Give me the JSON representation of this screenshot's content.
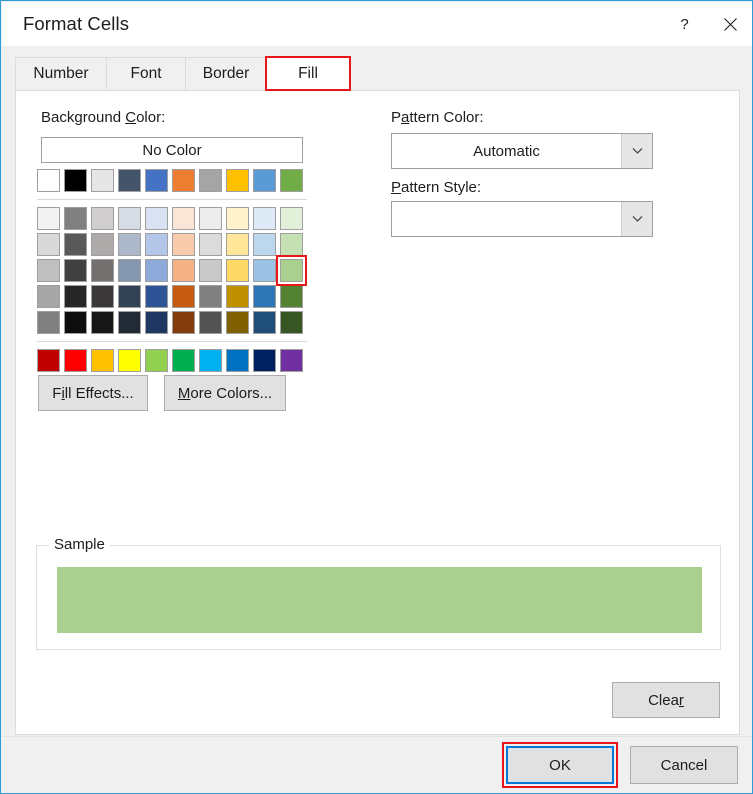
{
  "window": {
    "title": "Format Cells",
    "help_icon": "question-mark-icon",
    "close_icon": "close-icon",
    "border_color": "#2e9bd6"
  },
  "tabs": [
    {
      "label": "Number",
      "active": false,
      "highlighted": false
    },
    {
      "label": "Font",
      "active": false,
      "highlighted": false
    },
    {
      "label": "Border",
      "active": false,
      "highlighted": false
    },
    {
      "label": "Fill",
      "active": true,
      "highlighted": true
    }
  ],
  "fill_tab": {
    "background_color": {
      "label_before": "Background ",
      "label_accel": "C",
      "label_after": "olor:",
      "no_color_button": "No Color",
      "theme_colors": [
        "#FFFFFF",
        "#000000",
        "#E7E6E6",
        "#44546A",
        "#4472C4",
        "#ED7D31",
        "#A5A5A5",
        "#FFC000",
        "#5B9BD5",
        "#70AD47"
      ],
      "tint_shade_rows": [
        [
          "#F2F2F2",
          "#808080",
          "#D0CECE",
          "#D6DCE4",
          "#D9E2F3",
          "#FBE5D6",
          "#EDEDED",
          "#FFF2CC",
          "#DEEBF6",
          "#E2EFD9"
        ],
        [
          "#D9D9D9",
          "#595959",
          "#AEAAAA",
          "#ADB9CA",
          "#B4C6E7",
          "#F7CBAC",
          "#DBDBDB",
          "#FFE698",
          "#BDD7EE",
          "#C5E0B3"
        ],
        [
          "#BFBFBF",
          "#404040",
          "#757070",
          "#8496B0",
          "#8EAADB",
          "#F4B184",
          "#C9C9C9",
          "#FFD965",
          "#9CC3E5",
          "#A9D08E"
        ],
        [
          "#A6A6A6",
          "#262626",
          "#3A3838",
          "#334254",
          "#2F5496",
          "#C55A11",
          "#808080",
          "#BF9000",
          "#2E75B5",
          "#548235"
        ],
        [
          "#808080",
          "#0D0D0D",
          "#181717",
          "#222B35",
          "#1F3763",
          "#833C0B",
          "#535353",
          "#7F6000",
          "#1F4E79",
          "#375623"
        ]
      ],
      "standard_colors": [
        "#C00000",
        "#FF0000",
        "#FFC000",
        "#FFFF00",
        "#92D050",
        "#00B050",
        "#00B0F0",
        "#0070C0",
        "#002060",
        "#7030A0"
      ],
      "selected_swatch": {
        "row": "tint_shade_2",
        "column": 9,
        "color": "#A9D08E"
      },
      "selection_highlight_color": "#e8151b"
    },
    "fill_effects_button": {
      "label_before": "F",
      "label_accel": "i",
      "label_after": "ll Effects..."
    },
    "more_colors_button": {
      "label_accel": "M",
      "label_after": "ore Colors..."
    },
    "pattern_color": {
      "label_before": "P",
      "label_accel": "a",
      "label_after": "ttern Color:",
      "value": "Automatic",
      "arrow_icon": "chevron-down-icon"
    },
    "pattern_style": {
      "label_accel": "P",
      "label_after": "attern Style:",
      "value": "",
      "arrow_icon": "chevron-down-icon"
    },
    "sample": {
      "title": "Sample",
      "preview_color": "#A9D08E"
    },
    "clear_button": {
      "label_before": "Clea",
      "label_accel": "r"
    }
  },
  "footer": {
    "ok_button": "OK",
    "cancel_button": "Cancel",
    "ok_highlighted": true,
    "ok_focus_color": "#0078d7",
    "highlight_color": "#e8151b"
  }
}
